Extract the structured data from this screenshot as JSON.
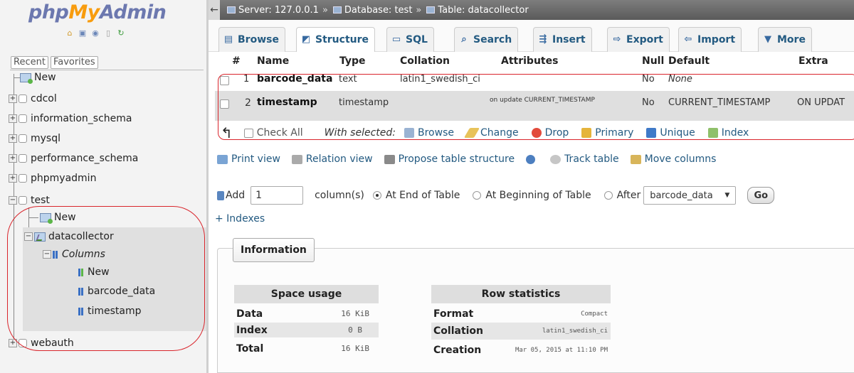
{
  "nav": {
    "logo": {
      "php": "php",
      "my": "My",
      "admin": "Admin"
    },
    "logo_icons": [
      "home-icon",
      "logout-icon",
      "help-icon",
      "docs-icon",
      "reload-icon"
    ],
    "tabs": [
      "Recent",
      "Favorites"
    ],
    "tree": {
      "new": "New",
      "cdcol": "cdcol",
      "information_schema": "information_schema",
      "mysql": "mysql",
      "performance_schema": "performance_schema",
      "phpmyadmin": "phpmyadmin",
      "test": "test",
      "test_new": "New",
      "datacollector": "datacollector",
      "columns": "Columns",
      "columns_new": "New",
      "col1": "barcode_data",
      "col2": "timestamp",
      "webauth": "webauth"
    }
  },
  "breadcrumb": {
    "server": "Server: 127.0.0.1",
    "database": "Database: test",
    "table": "Table: datacollector"
  },
  "tabs": [
    {
      "label": "Browse",
      "icon": "browse-icon"
    },
    {
      "label": "Structure",
      "icon": "structure-icon"
    },
    {
      "label": "SQL",
      "icon": "sql-icon"
    },
    {
      "label": "Search",
      "icon": "search-icon"
    },
    {
      "label": "Insert",
      "icon": "insert-icon"
    },
    {
      "label": "Export",
      "icon": "export-icon"
    },
    {
      "label": "Import",
      "icon": "import-icon"
    },
    {
      "label": "More",
      "icon": "more-icon"
    }
  ],
  "structure": {
    "headers": {
      "num": "#",
      "name": "Name",
      "type": "Type",
      "collation": "Collation",
      "attributes": "Attributes",
      "null": "Null",
      "default": "Default",
      "extra": "Extra"
    },
    "rows": [
      {
        "num": "1",
        "name": "barcode_data",
        "type": "text",
        "collation": "latin1_swedish_ci",
        "attributes": "",
        "null": "No",
        "default": "None",
        "extra": ""
      },
      {
        "num": "2",
        "name": "timestamp",
        "type": "timestamp",
        "collation": "",
        "attributes": "on update CURRENT_TIMESTAMP",
        "null": "No",
        "default": "CURRENT_TIMESTAMP",
        "extra": "ON UPDAT"
      }
    ]
  },
  "with_selected": {
    "check_all": "Check All",
    "label": "With selected:",
    "actions": [
      "Browse",
      "Change",
      "Drop",
      "Primary",
      "Unique",
      "Index"
    ]
  },
  "links": [
    "Print view",
    "Relation view",
    "Propose table structure",
    "Track table",
    "Move columns"
  ],
  "add_columns": {
    "add_label": "Add",
    "count": "1",
    "columns_label": "column(s)",
    "at_end": "At End of Table",
    "at_beginning": "At Beginning of Table",
    "after": "After",
    "after_select": "barcode_data",
    "go": "Go"
  },
  "indexes_link": "+ Indexes",
  "information": {
    "legend": "Information",
    "space_usage": {
      "title": "Space usage",
      "rows": [
        {
          "key": "Data",
          "value": "16 KiB"
        },
        {
          "key": "Index",
          "value": "0 B"
        },
        {
          "key": "Total",
          "value": "16 KiB"
        }
      ]
    },
    "row_statistics": {
      "title": "Row statistics",
      "rows": [
        {
          "key": "Format",
          "value": "Compact"
        },
        {
          "key": "Collation",
          "value": "latin1_swedish_ci"
        },
        {
          "key": "Creation",
          "value": "Mar 05, 2015 at 11:10 PM"
        }
      ]
    }
  },
  "colors": {
    "link": "#235a81",
    "annotation": "#d9252c",
    "logo_blue": "#6c78af",
    "logo_orange": "#f89c0e"
  }
}
